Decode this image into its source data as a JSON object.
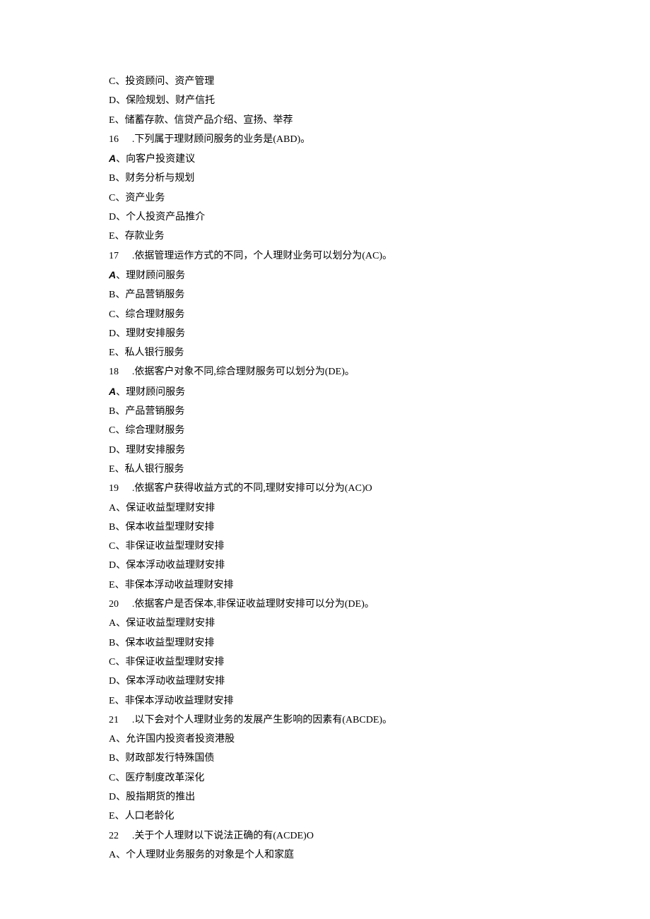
{
  "lines": [
    {
      "kind": "opt",
      "label": "C、",
      "text": "投资顾问、资产管理"
    },
    {
      "kind": "opt",
      "label": "D、",
      "text": "保险规划、财产信托"
    },
    {
      "kind": "opt",
      "label": "E、",
      "text": "储蓄存款、信贷产品介绍、宣扬、举荐"
    },
    {
      "kind": "q",
      "num": "16",
      "sep": " .",
      "text": "下列属于理财顾问服务的业务是(ABD)。"
    },
    {
      "kind": "optA",
      "label": "A",
      "text": "、向客户投资建议"
    },
    {
      "kind": "opt",
      "label": "B、",
      "text": "财务分析与规划"
    },
    {
      "kind": "opt",
      "label": "C、",
      "text": "资产业务"
    },
    {
      "kind": "opt",
      "label": "D、",
      "text": "个人投资产品推介"
    },
    {
      "kind": "opt",
      "label": "E、",
      "text": "存款业务"
    },
    {
      "kind": "q",
      "num": "17",
      "sep": " .",
      "text": "依据管理运作方式的不同，个人理财业务可以划分为(AC)。"
    },
    {
      "kind": "optA",
      "label": "A",
      "text": "、理财顾问服务"
    },
    {
      "kind": "opt",
      "label": "B、",
      "text": "产品营销服务"
    },
    {
      "kind": "opt",
      "label": "C、",
      "text": "综合理财服务"
    },
    {
      "kind": "opt",
      "label": "D、",
      "text": "理财安排服务"
    },
    {
      "kind": "opt",
      "label": "E、",
      "text": "私人银行服务"
    },
    {
      "kind": "q",
      "num": "18",
      "sep": " .",
      "text": "依据客户对象不同,综合理财服务可以划分为(DE)。"
    },
    {
      "kind": "optA",
      "label": "A",
      "text": "、理财顾问服务"
    },
    {
      "kind": "opt",
      "label": "B、",
      "text": "产品营销服务"
    },
    {
      "kind": "opt",
      "label": "C、",
      "text": "综合理财服务"
    },
    {
      "kind": "opt",
      "label": "D、",
      "text": "理财安排服务"
    },
    {
      "kind": "opt",
      "label": "E、",
      "text": "私人银行服务"
    },
    {
      "kind": "q",
      "num": "19",
      "sep": " .",
      "text": "依据客户获得收益方式的不同,理财安排可以分为(AC)O"
    },
    {
      "kind": "opt",
      "label": "A、",
      "text": "保证收益型理财安排"
    },
    {
      "kind": "opt",
      "label": "B、",
      "text": "保本收益型理财安排"
    },
    {
      "kind": "opt",
      "label": "C、",
      "text": "非保证收益型理财安排"
    },
    {
      "kind": "opt",
      "label": "D、",
      "text": "保本浮动收益理财安排"
    },
    {
      "kind": "opt",
      "label": "E、",
      "text": "非保本浮动收益理财安排"
    },
    {
      "kind": "q",
      "num": "20",
      "sep": " .",
      "text": "依据客户是否保本,非保证收益理财安排可以分为(DE)。"
    },
    {
      "kind": "opt",
      "label": "A、",
      "text": "保证收益型理财安排"
    },
    {
      "kind": "opt",
      "label": "B、",
      "text": "保本收益型理财安排"
    },
    {
      "kind": "opt",
      "label": "C、",
      "text": "非保证收益型理财安排"
    },
    {
      "kind": "opt",
      "label": "D、",
      "text": "保本浮动收益理财安排"
    },
    {
      "kind": "opt",
      "label": "E、",
      "text": "非保本浮动收益理财安排"
    },
    {
      "kind": "q",
      "num": "21",
      "sep": " .",
      "text": "以下会对个人理财业务的发展产生影响的因素有(ABCDE)。"
    },
    {
      "kind": "opt",
      "label": "A、",
      "text": "允许国内投资者投资港股"
    },
    {
      "kind": "opt",
      "label": "B、",
      "text": "财政部发行特殊国债"
    },
    {
      "kind": "opt",
      "label": "C、",
      "text": "医疗制度改革深化"
    },
    {
      "kind": "opt",
      "label": "D、",
      "text": "股指期货的推出"
    },
    {
      "kind": "opt",
      "label": "E、",
      "text": "人口老龄化"
    },
    {
      "kind": "q",
      "num": "22",
      "sep": " .",
      "text": "关于个人理财以下说法正确的有(ACDE)O"
    },
    {
      "kind": "opt",
      "label": "A、",
      "text": "个人理财业务服务的对象是个人和家庭"
    }
  ]
}
